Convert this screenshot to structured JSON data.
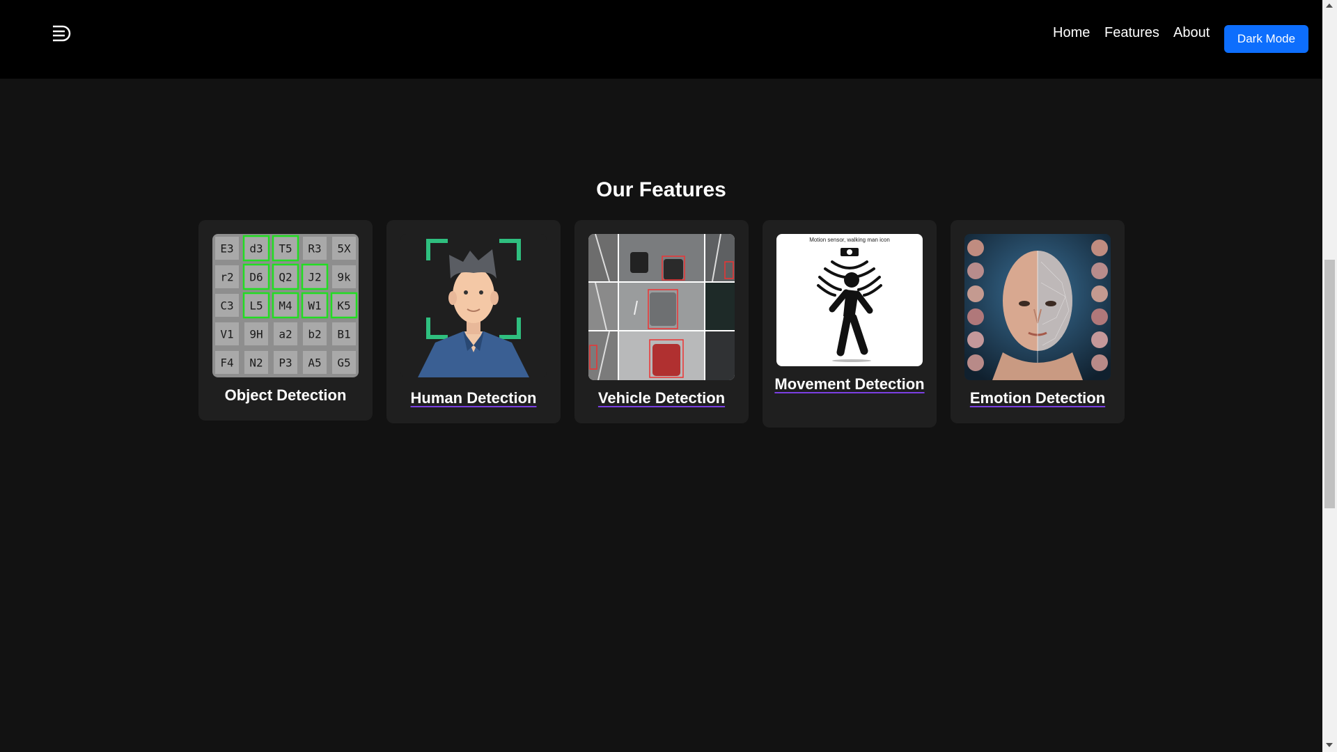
{
  "header": {
    "logo_icon": "stacked-lines-logo-icon",
    "nav": [
      {
        "label": "Home"
      },
      {
        "label": "Features"
      },
      {
        "label": "About"
      }
    ],
    "dark_mode_label": "Dark Mode",
    "accent_color": "#0d6efd"
  },
  "features": {
    "title": "Our Features",
    "cards": [
      {
        "label": "Object Detection",
        "image": "character-grid-detection-image",
        "link": false
      },
      {
        "label": "Human Detection",
        "image": "face-scan-person-image",
        "link": true
      },
      {
        "label": "Vehicle Detection",
        "image": "traffic-camera-grid-image",
        "link": true
      },
      {
        "label": "Movement Detection",
        "image": "motion-sensor-walking-man-image",
        "caption": "Motion sensor, walking man icon",
        "link": true
      },
      {
        "label": "Emotion Detection",
        "image": "face-emotion-mesh-image",
        "link": true
      }
    ],
    "object_grid": [
      [
        "E3",
        "d3",
        "T5",
        "R3",
        "5X"
      ],
      [
        "r2",
        "D6",
        "Q2",
        "J2",
        "9k"
      ],
      [
        "C3",
        "L5",
        "M4",
        "W1",
        "K5"
      ],
      [
        "V1",
        "9H",
        "a2",
        "b2",
        "B1"
      ],
      [
        "F4",
        "N2",
        "P3",
        "A5",
        "G5"
      ]
    ]
  },
  "colors": {
    "background": "#121212",
    "header": "#000000",
    "card": "#1f1f1f",
    "underline": "#7b3fe4",
    "detect_green": "#22dd22",
    "face_bracket": "#2fbf7f"
  }
}
